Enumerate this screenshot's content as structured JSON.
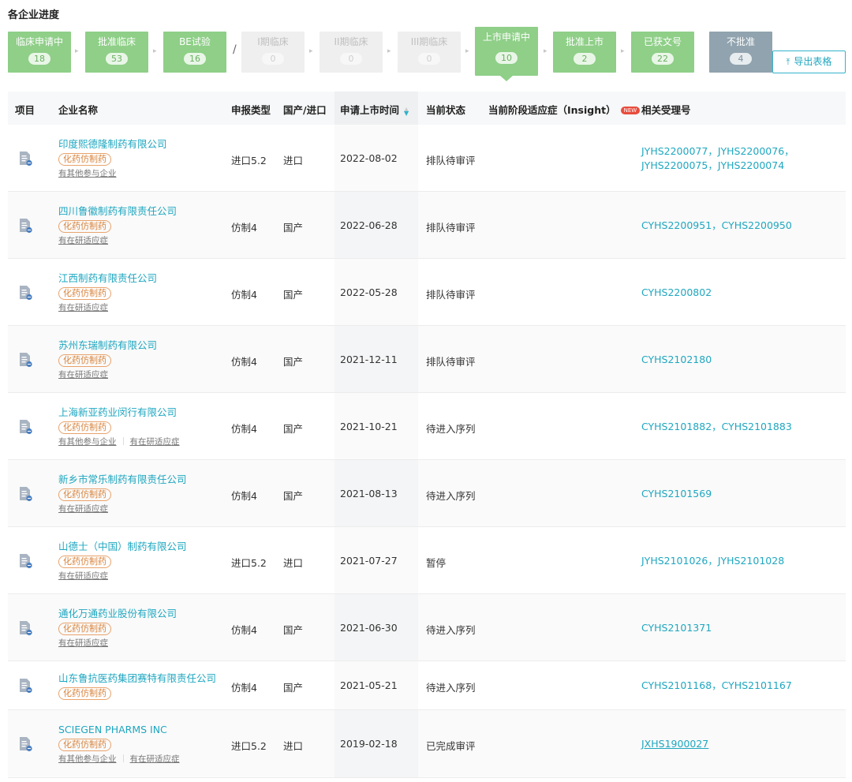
{
  "section_title": "各企业进度",
  "stages": [
    {
      "label": "临床申请中",
      "count": "18"
    },
    {
      "label": "批准临床",
      "count": "53"
    },
    {
      "label": "BE试验",
      "count": "16"
    },
    {
      "label": "I期临床",
      "count": "0"
    },
    {
      "label": "II期临床",
      "count": "0"
    },
    {
      "label": "III期临床",
      "count": "0"
    },
    {
      "label": "上市申请中",
      "count": "10"
    },
    {
      "label": "批准上市",
      "count": "2"
    },
    {
      "label": "已获文号",
      "count": "22"
    },
    {
      "label": "不批准",
      "count": "4"
    }
  ],
  "stage_separator": "/",
  "export": {
    "label": "导出表格",
    "icon": "upload-icon"
  },
  "table": {
    "headers": {
      "item": "项目",
      "company": "企业名称",
      "type": "申报类型",
      "origin": "国产/进口",
      "date": "申请上市时间",
      "status": "当前状态",
      "indication": "当前阶段适应症（Insight）",
      "new_badge": "NEW",
      "acceptance": "相关受理号"
    },
    "rows": [
      {
        "company": "印度熙德隆制药有限公司",
        "tag": "化药仿制药",
        "links": [
          "有其他参与企业"
        ],
        "type": "进口5.2",
        "origin": "进口",
        "date": "2022-08-02",
        "status": "排队待审评",
        "acceptance": "JYHS2200077，JYHS2200076，JYHS2200075，JYHS2200074"
      },
      {
        "company": "四川鲁徽制药有限责任公司",
        "tag": "化药仿制药",
        "links": [
          "有在研适应症"
        ],
        "type": "仿制4",
        "origin": "国产",
        "date": "2022-06-28",
        "status": "排队待审评",
        "acceptance": "CYHS2200951，CYHS2200950"
      },
      {
        "company": "江西制药有限责任公司",
        "tag": "化药仿制药",
        "links": [
          "有在研适应症"
        ],
        "type": "仿制4",
        "origin": "国产",
        "date": "2022-05-28",
        "status": "排队待审评",
        "acceptance": "CYHS2200802"
      },
      {
        "company": "苏州东瑞制药有限公司",
        "tag": "化药仿制药",
        "links": [
          "有在研适应症"
        ],
        "type": "仿制4",
        "origin": "国产",
        "date": "2021-12-11",
        "status": "排队待审评",
        "acceptance": "CYHS2102180"
      },
      {
        "company": "上海新亚药业闵行有限公司",
        "tag": "化药仿制药",
        "links": [
          "有其他参与企业",
          "有在研适应症"
        ],
        "type": "仿制4",
        "origin": "国产",
        "date": "2021-10-21",
        "status": "待进入序列",
        "acceptance": "CYHS2101882，CYHS2101883"
      },
      {
        "company": "新乡市常乐制药有限责任公司",
        "tag": "化药仿制药",
        "links": [
          "有在研适应症"
        ],
        "type": "仿制4",
        "origin": "国产",
        "date": "2021-08-13",
        "status": "待进入序列",
        "acceptance": "CYHS2101569"
      },
      {
        "company": "山德士（中国）制药有限公司",
        "tag": "化药仿制药",
        "links": [
          "有在研适应症"
        ],
        "type": "进口5.2",
        "origin": "进口",
        "date": "2021-07-27",
        "status": "暂停",
        "acceptance": "JYHS2101026，JYHS2101028"
      },
      {
        "company": "通化万通药业股份有限公司",
        "tag": "化药仿制药",
        "links": [
          "有在研适应症"
        ],
        "type": "仿制4",
        "origin": "国产",
        "date": "2021-06-30",
        "status": "待进入序列",
        "acceptance": "CYHS2101371"
      },
      {
        "company": "山东鲁抗医药集团赛特有限责任公司",
        "tag": "化药仿制药",
        "links": [],
        "type": "仿制4",
        "origin": "国产",
        "date": "2021-05-21",
        "status": "待进入序列",
        "acceptance": "CYHS2101168，CYHS2101167"
      },
      {
        "company": "SCIEGEN PHARMS INC",
        "tag": "化药仿制药",
        "links": [
          "有其他参与企业",
          "有在研适应症"
        ],
        "type": "进口5.2",
        "origin": "进口",
        "date": "2019-02-18",
        "status": "已完成审评",
        "acceptance": "JXHS1900027"
      }
    ]
  },
  "colors": {
    "green": "#8fcf88",
    "gray": "#efefef",
    "slate": "#90a3ae",
    "link": "#1fa7c0",
    "tag": "#d9853f",
    "badge": "#e84c3d"
  }
}
